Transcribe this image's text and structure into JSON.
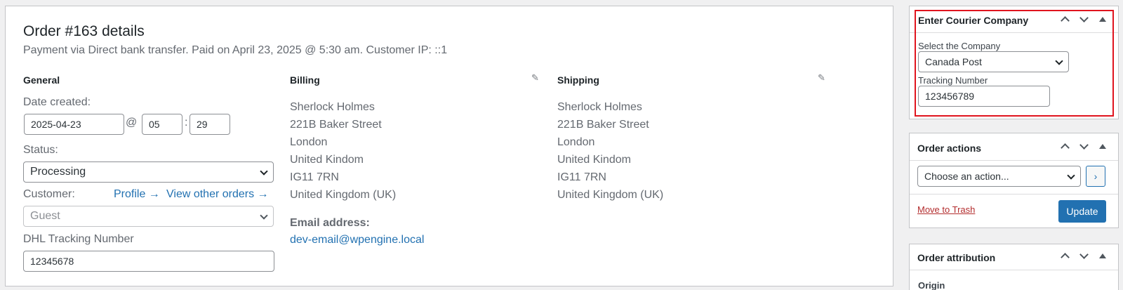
{
  "order": {
    "title": "Order #163 details",
    "subtitle": "Payment via Direct bank transfer. Paid on April 23, 2025 @ 5:30 am. Customer IP: ::1"
  },
  "general": {
    "heading": "General",
    "date_label": "Date created:",
    "date_value": "2025-04-23",
    "at_sep": "@",
    "hour": "05",
    "colon": ":",
    "minute": "29",
    "status_label": "Status:",
    "status_value": "Processing",
    "customer_label": "Customer:",
    "profile_link": "Profile →",
    "other_orders_link": "View other orders →",
    "customer_value": "Guest",
    "dhl_label": "DHL Tracking Number",
    "dhl_value": "12345678"
  },
  "billing": {
    "heading": "Billing",
    "lines": [
      "Sherlock Holmes",
      "221B Baker Street",
      "London",
      "United Kindom",
      "IG11 7RN",
      "United Kingdom (UK)"
    ],
    "email_label": "Email address:",
    "email_value": "dev-email@wpengine.local"
  },
  "shipping": {
    "heading": "Shipping",
    "lines": [
      "Sherlock Holmes",
      "221B Baker Street",
      "London",
      "United Kindom",
      "IG11 7RN",
      "United Kingdom (UK)"
    ]
  },
  "courier": {
    "heading": "Enter Courier Company",
    "company_label": "Select the Company",
    "company_value": "Canada Post",
    "tracking_label": "Tracking Number",
    "tracking_value": "123456789"
  },
  "order_actions": {
    "heading": "Order actions",
    "select_value": "Choose an action...",
    "go_label": "›",
    "trash_label": "Move to Trash",
    "update_label": "Update"
  },
  "attribution": {
    "heading": "Order attribution",
    "origin_label": "Origin"
  },
  "colors": {
    "accent": "#2271b1",
    "highlight": "#e0141e",
    "trash": "#b32d2e"
  }
}
